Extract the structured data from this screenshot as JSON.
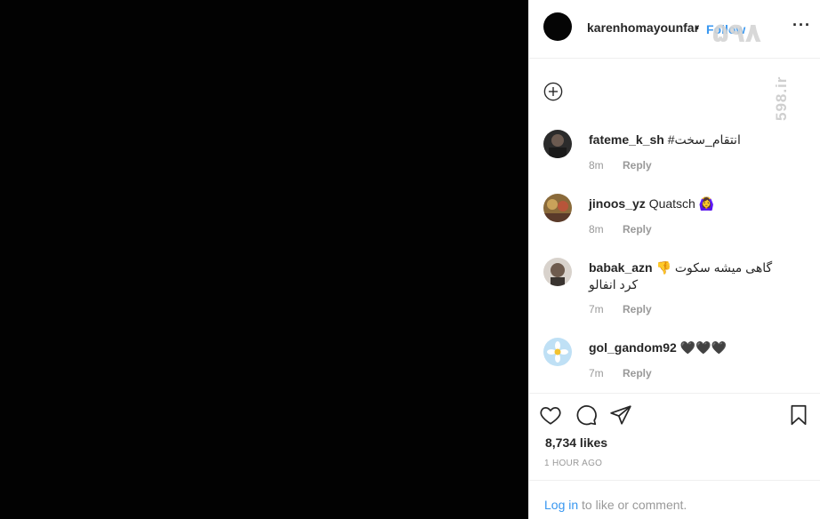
{
  "post": {
    "username": "karenhomayounfar",
    "separator": "•",
    "follow_label": "Follow",
    "more_icon": "more-options-icon",
    "more_label": "···"
  },
  "watermark": {
    "logo_text": "۵۹۸",
    "side_text": "598.ir"
  },
  "comments": [
    {
      "username": "fateme_k_sh",
      "text": "#انتقام_سخت",
      "age": "8m",
      "reply": "Reply"
    },
    {
      "username": "jinoos_yz",
      "text": "Quatsch 🙆‍♀️",
      "age": "8m",
      "reply": "Reply"
    },
    {
      "username": "babak_azn",
      "text": "👎 گاهی میشه سکوت کرد انفالو",
      "age": "7m",
      "reply": "Reply"
    },
    {
      "username": "gol_gandom92",
      "text": "🖤🖤🖤",
      "age": "7m",
      "reply": "Reply"
    }
  ],
  "engagement": {
    "likes": "8,734 likes",
    "timestamp": "1 HOUR AGO",
    "icons": [
      "heart-icon",
      "comment-icon",
      "share-icon",
      "bookmark-icon"
    ]
  },
  "footer": {
    "login_link": "Log in",
    "login_suffix": " to like or comment."
  },
  "colors": {
    "accent": "#3897f0",
    "muted": "#999999",
    "text": "#262626",
    "media_background": "#020202"
  }
}
